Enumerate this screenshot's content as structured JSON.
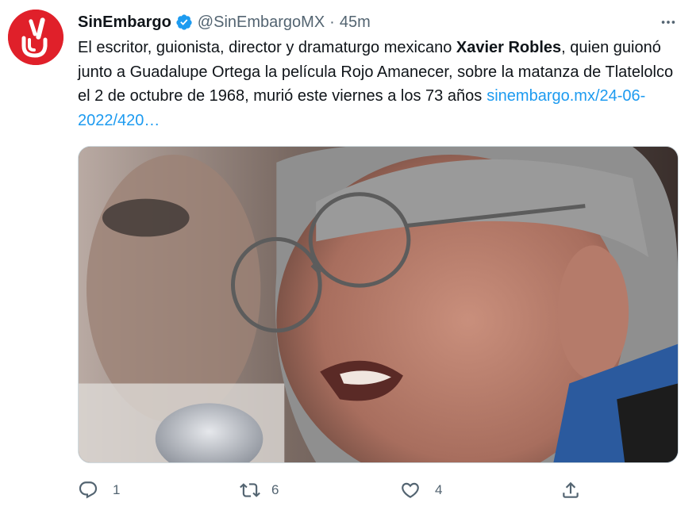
{
  "tweet": {
    "display_name": "SinEmbargo",
    "handle": "@SinEmbargoMX",
    "separator": "·",
    "time": "45m",
    "text_before": "El escritor, guionista, director y dramaturgo mexicano ",
    "text_bold": "Xavier Robles",
    "text_after": ", quien guionó junto a Guadalupe Ortega la película Rojo Amanecer, sobre la matanza de Tlatelolco el 2 de octubre de 1968, murió este viernes a los 73 años",
    "link": "sinembargo.mx/24-06-2022/420…"
  },
  "actions": {
    "reply_count": "1",
    "retweet_count": "6",
    "like_count": "4"
  },
  "icons": {
    "avatar": "sinembargo-logo",
    "verified": "verified-badge-icon",
    "more": "more-dots-icon",
    "reply": "reply-icon",
    "retweet": "retweet-icon",
    "like": "heart-icon",
    "share": "share-icon"
  },
  "colors": {
    "brand_red": "#e0202a",
    "link_blue": "#1d9bf0",
    "verified_blue": "#1d9bf0",
    "muted_gray": "#536471",
    "text": "#0f1419"
  }
}
